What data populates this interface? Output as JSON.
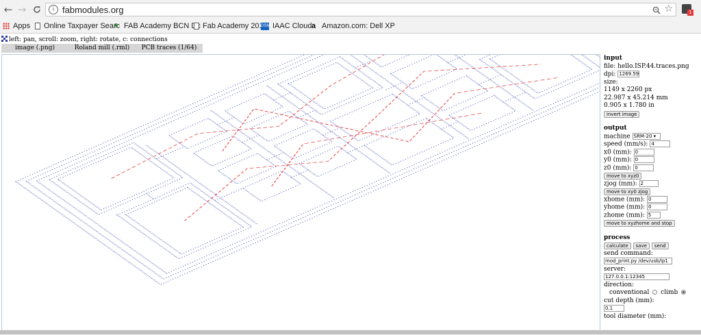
{
  "browser": {
    "url": "fabmodules.org",
    "bookmarks": [
      {
        "label": "Apps",
        "icon": "apps-grid-icon"
      },
      {
        "label": "Online Taxpayer Searc",
        "icon": "document-icon"
      },
      {
        "label": "FAB Academy BCN Dc",
        "icon": "fab-icon"
      },
      {
        "label": "Fab Academy 2017",
        "icon": "document-icon"
      },
      {
        "label": "IAAC Cloud",
        "icon": "dsm-icon"
      },
      {
        "label": "Amazon.com: Dell XP",
        "icon": "amazon-icon"
      }
    ],
    "extension_badge": "1",
    "icons": {
      "back": "←",
      "forward": "→",
      "reload": "C",
      "info": "i",
      "zoom": "⌕",
      "star": "☆"
    }
  },
  "page": {
    "instructions": "left: pan, scroll: zoom, right: rotate, c: connections",
    "tabs": [
      "image (.png)",
      "Roland mill (.rml)",
      "PCB traces (1/64)"
    ]
  },
  "input": {
    "title": "input",
    "file_label": "file: hello.ISP.44.traces.png",
    "dpi_label": "dpi:",
    "dpi_value": "1269.59",
    "size_label": "size:",
    "size_px": "1149 x 2260 px",
    "size_mm": "22.987 x 45.214 mm",
    "size_in": "0.905 x 1.780 in",
    "invert_button": "invert image"
  },
  "output": {
    "title": "output",
    "machine_label": "machine",
    "machine_value": "SRM-20 ▾",
    "speed_label": "speed (mm/s):",
    "speed_value": "4",
    "x0_label": "x0 (mm):",
    "x0_value": "0",
    "y0_label": "y0 (mm):",
    "y0_value": "0",
    "z0_label": "z0 (mm):",
    "z0_value": "0",
    "move_xyz0_button": "move to xyz0",
    "zjog_label": "zjog (mm):",
    "zjog_value": "2",
    "move_xy0_zjog_button": "move to xy0 zjog",
    "xhome_label": "xhome (mm):",
    "xhome_value": "0",
    "yhome_label": "yhome (mm):",
    "yhome_value": "0",
    "zhome_label": "zhome (mm):",
    "zhome_value": "5",
    "move_home_button": "move to xyzhome and stop"
  },
  "process": {
    "title": "process",
    "calculate_button": "calculate",
    "save_button": "save",
    "send_button": "send",
    "send_command_label": "send command:",
    "send_command_value": "mod_print.py /dev/usb/lp1",
    "server_label": "server:",
    "server_value": "127.0.0.1:12345",
    "direction_label": "direction:",
    "conventional_label": "conventional",
    "climb_label": "climb",
    "direction_selected": "climb",
    "cut_depth_label": "cut depth (mm):",
    "cut_depth_value": "0.1",
    "tool_diameter_label": "tool diameter (mm):"
  },
  "colors": {
    "trace": "#2b3aa8",
    "connection": "#e53935",
    "tab_bar": "#d6d6d6"
  }
}
